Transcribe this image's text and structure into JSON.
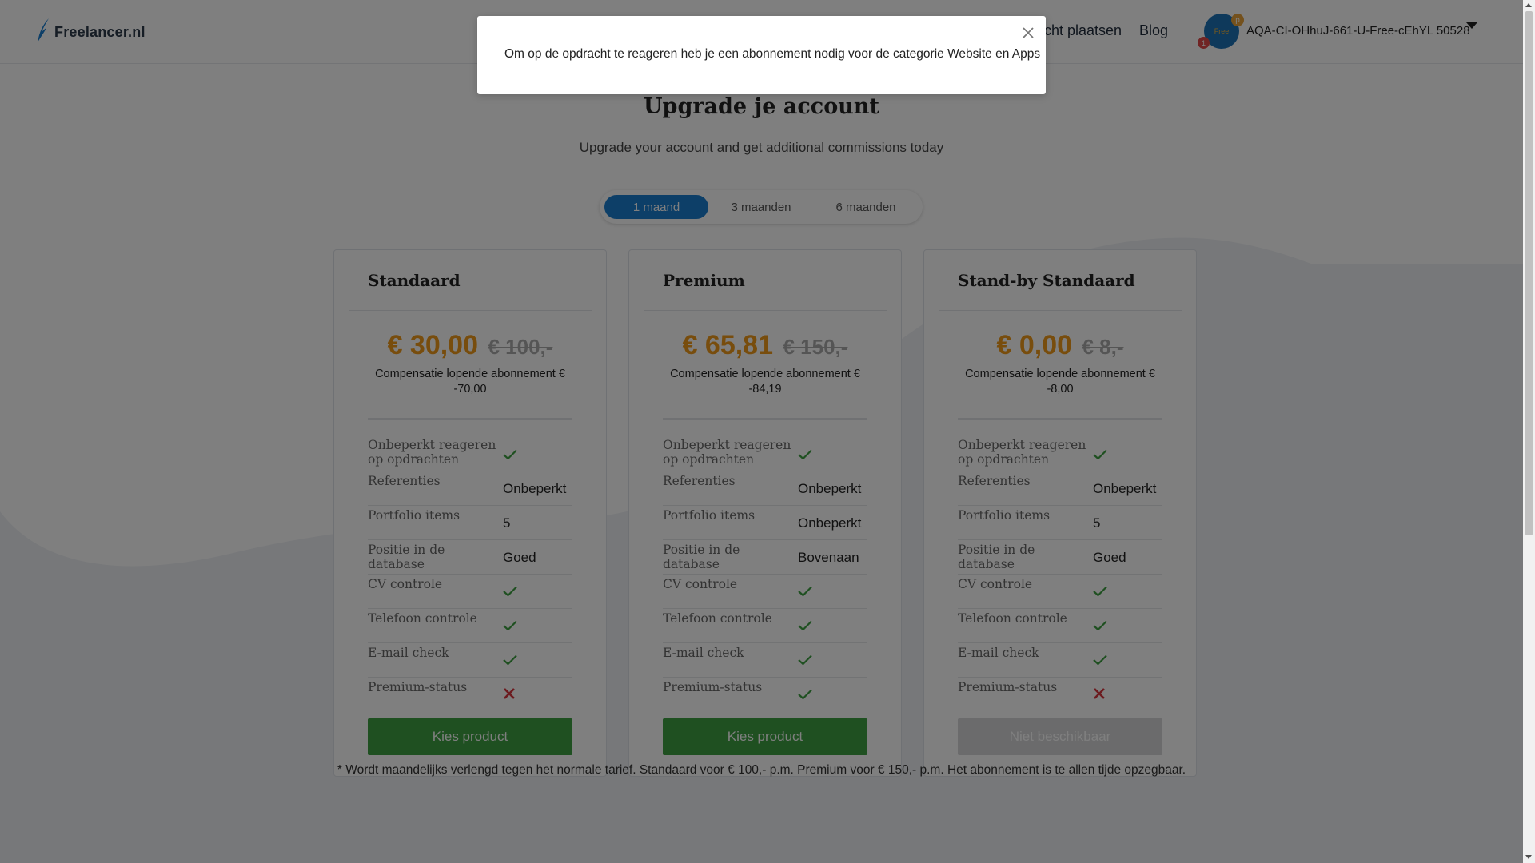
{
  "header": {
    "logo_text": "Freelancer.nl",
    "nav": [
      {
        "label": "cht plaatsen"
      },
      {
        "label": "Blog"
      }
    ],
    "user": {
      "name": "AQA-CI-OHhuJ-661-U-Free-cEhYL 50528",
      "avatar_text": "Free",
      "notification_count": "1",
      "badge": "p"
    }
  },
  "modal": {
    "message": "Om op de opdracht te reageren heb je een abonnement nodig voor de categorie Website en Apps"
  },
  "page": {
    "title": "Upgrade je account",
    "subtitle": "Upgrade your account and get additional commissions today"
  },
  "periods": {
    "selected": "1 maand",
    "options": [
      "1 maand",
      "3 maanden",
      "6 maanden"
    ]
  },
  "plans": [
    {
      "name": "Standaard",
      "price": "€ 30,00",
      "old_price": "€ 100,-",
      "compensation": "Compensatie lopende abonnement € -70,00",
      "features": [
        {
          "label": "Onbeperkt reageren op opdrachten",
          "value": "check"
        },
        {
          "label": "Referenties",
          "value": "Onbeperkt"
        },
        {
          "label": "Portfolio items",
          "value": "5"
        },
        {
          "label": "Positie in de database",
          "value": "Goed"
        },
        {
          "label": "CV controle",
          "value": "check"
        },
        {
          "label": "Telefoon controle",
          "value": "check"
        },
        {
          "label": "E-mail check",
          "value": "check"
        },
        {
          "label": "Premium-status",
          "value": "cross"
        }
      ],
      "cta": "Kies product",
      "available": true
    },
    {
      "name": "Premium",
      "price": "€ 65,81",
      "old_price": "€ 150,-",
      "compensation": "Compensatie lopende abonnement € -84,19",
      "features": [
        {
          "label": "Onbeperkt reageren op opdrachten",
          "value": "check"
        },
        {
          "label": "Referenties",
          "value": "Onbeperkt"
        },
        {
          "label": "Portfolio items",
          "value": "Onbeperkt"
        },
        {
          "label": "Positie in de database",
          "value": "Bovenaan"
        },
        {
          "label": "CV controle",
          "value": "check"
        },
        {
          "label": "Telefoon controle",
          "value": "check"
        },
        {
          "label": "E-mail check",
          "value": "check"
        },
        {
          "label": "Premium-status",
          "value": "check"
        }
      ],
      "cta": "Kies product",
      "available": true
    },
    {
      "name": "Stand-by Standaard",
      "price": "€ 0,00",
      "old_price": "€ 8,-",
      "compensation": "Compensatie lopende abonnement € -8,00",
      "features": [
        {
          "label": "Onbeperkt reageren op opdrachten",
          "value": "check"
        },
        {
          "label": "Referenties",
          "value": "Onbeperkt"
        },
        {
          "label": "Portfolio items",
          "value": "5"
        },
        {
          "label": "Positie in de database",
          "value": "Goed"
        },
        {
          "label": "CV controle",
          "value": "check"
        },
        {
          "label": "Telefoon controle",
          "value": "check"
        },
        {
          "label": "E-mail check",
          "value": "check"
        },
        {
          "label": "Premium-status",
          "value": "cross"
        }
      ],
      "cta": "Niet beschikbaar",
      "available": false
    }
  ],
  "footnote": "* Wordt maandelijks verlengd tegen het normale tarief. Standaard voor € 100,- p.m. Premium voor € 150,- p.m. Het abonnement is te allen tijde opzegbaar.",
  "colors": {
    "accent_blue": "#1b7fd0",
    "price_orange": "#f09a1a",
    "check_green": "#3fa142",
    "cross_red": "#d9363e",
    "disabled_gray": "#d6d7d9"
  },
  "icons": {
    "logo": "feather-icon",
    "user_menu": "caret-down-icon",
    "modal_close": "close-icon",
    "included": "check-icon",
    "excluded": "cross-icon"
  }
}
